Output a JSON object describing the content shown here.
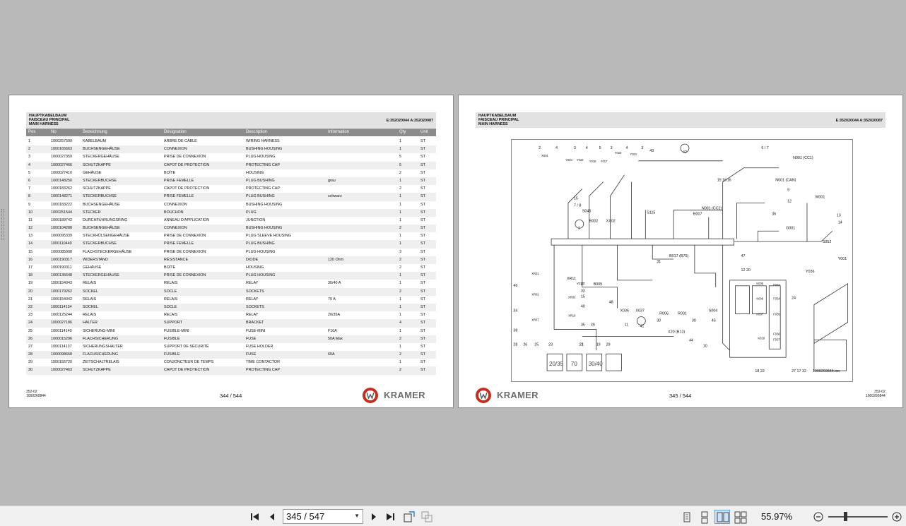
{
  "left_page": {
    "header": {
      "line1": "HAUPTKABELBAUM",
      "line2": "FAISCEAU PRINCIPAL",
      "line3": "MAIN HARNESS",
      "reference": "E:352020044 A:352020087"
    },
    "columns": {
      "pos": "Pos",
      "no": "No",
      "bezeichnung": "Bezeichnung",
      "designation": "Désignation",
      "description": "Description",
      "information": "Information",
      "qty": "Qty",
      "unit": "Unit"
    },
    "rows": [
      {
        "pos": "1",
        "no": "1000257509",
        "bez": "KABELBAUM",
        "des": "ARBRE DE CÂBLE",
        "dsc": "WIRING HARNESS",
        "inf": "",
        "qty": "1",
        "unit": "ST"
      },
      {
        "pos": "2",
        "no": "1000165663",
        "bez": "BUCHSENGEHÄUSE",
        "des": "CONNEXION",
        "dsc": "BUSHING HOUSING",
        "inf": "",
        "qty": "1",
        "unit": "ST"
      },
      {
        "pos": "3",
        "no": "1000027359",
        "bez": "STECKERGEHÄUSE",
        "des": "PRISE DE CONNEXION",
        "dsc": "PLUG HOUSING",
        "inf": "",
        "qty": "5",
        "unit": "ST"
      },
      {
        "pos": "4",
        "no": "1000027466",
        "bez": "SCHUTZKAPPE",
        "des": "CAPOT DE PROTECTION",
        "dsc": "PROTECTING CAP",
        "inf": "",
        "qty": "5",
        "unit": "ST"
      },
      {
        "pos": "5",
        "no": "1000027410",
        "bez": "GEHÄUSE",
        "des": "BOÎTE",
        "dsc": "HOUSING",
        "inf": "",
        "qty": "2",
        "unit": "ST"
      },
      {
        "pos": "6",
        "no": "1000148250",
        "bez": "STECKERBUCHSE",
        "des": "PRISE FEMELLE",
        "dsc": "PLUG BUSHING",
        "inf": "grau",
        "qty": "1",
        "unit": "ST"
      },
      {
        "pos": "7",
        "no": "1000183262",
        "bez": "SCHUTZKAPPE",
        "des": "CAPOT DE PROTECTION",
        "dsc": "PROTECTING CAP",
        "inf": "",
        "qty": "2",
        "unit": "ST"
      },
      {
        "pos": "8",
        "no": "1000148271",
        "bez": "STECKERBUCHSE",
        "des": "PRISE FEMELLE",
        "dsc": "PLUG BUSHING",
        "inf": "schwarz",
        "qty": "1",
        "unit": "ST"
      },
      {
        "pos": "9",
        "no": "1000183222",
        "bez": "BUCHSENGEHÄUSE",
        "des": "CONNEXION",
        "dsc": "BUSHING HOUSING",
        "inf": "",
        "qty": "1",
        "unit": "ST"
      },
      {
        "pos": "10",
        "no": "1000251544",
        "bez": "STECKER",
        "des": "BOUCHON",
        "dsc": "PLUG",
        "inf": "",
        "qty": "1",
        "unit": "ST"
      },
      {
        "pos": "11",
        "no": "1000189742",
        "bez": "DURCHFÜHRUNGSRING",
        "des": "ANNEAU D'APPLICATION",
        "dsc": "JUNCTION",
        "inf": "",
        "qty": "1",
        "unit": "ST"
      },
      {
        "pos": "12",
        "no": "1000104288",
        "bez": "BUCHSENGEHÄUSE",
        "des": "CONNEXION",
        "dsc": "BUSHING HOUSING",
        "inf": "",
        "qty": "2",
        "unit": "ST"
      },
      {
        "pos": "13",
        "no": "1000095339",
        "bez": "STECKHÜLSENGEHÄUSE",
        "des": "PRISE DE CONNEXION",
        "dsc": "PLUG SLEEVE HOUSING",
        "inf": "",
        "qty": "1",
        "unit": "ST"
      },
      {
        "pos": "14",
        "no": "1000110449",
        "bez": "STECKERBUCHSE",
        "des": "PRISE FEMELLE",
        "dsc": "PLUG BUSHING",
        "inf": "",
        "qty": "1",
        "unit": "ST"
      },
      {
        "pos": "15",
        "no": "1000085008",
        "bez": "FLACHSTECKERGEHÄUSE",
        "des": "PRISE DE CONNEXION",
        "dsc": "PLUG HOUSING",
        "inf": "",
        "qty": "3",
        "unit": "ST"
      },
      {
        "pos": "16",
        "no": "1000190317",
        "bez": "WIDERSTAND",
        "des": "RÉSISTANCE",
        "dsc": "DIODE",
        "inf": "120 Ohm",
        "qty": "2",
        "unit": "ST"
      },
      {
        "pos": "17",
        "no": "1000190311",
        "bez": "GEHÄUSE",
        "des": "BOÎTE",
        "dsc": "HOUSING",
        "inf": "",
        "qty": "2",
        "unit": "ST"
      },
      {
        "pos": "18",
        "no": "1000135648",
        "bez": "STECKERGEHÄUSE",
        "des": "PRISE DE CONNEXION",
        "dsc": "PLUG HOUSING",
        "inf": "",
        "qty": "1",
        "unit": "ST"
      },
      {
        "pos": "19",
        "no": "1000154043",
        "bez": "RELAIS",
        "des": "RELAIS",
        "dsc": "RELAY",
        "inf": "30/40 A",
        "qty": "1",
        "unit": "ST"
      },
      {
        "pos": "20",
        "no": "1000179262",
        "bez": "SOCKEL",
        "des": "SOCLE",
        "dsc": "SOCKETS",
        "inf": "",
        "qty": "2",
        "unit": "ST"
      },
      {
        "pos": "21",
        "no": "1000154042",
        "bez": "RELAIS",
        "des": "RELAIS",
        "dsc": "RELAY",
        "inf": "70 A",
        "qty": "1",
        "unit": "ST"
      },
      {
        "pos": "22",
        "no": "1000114134",
        "bez": "SOCKEL",
        "des": "SOCLE",
        "dsc": "SOCKETS",
        "inf": "",
        "qty": "1",
        "unit": "ST"
      },
      {
        "pos": "23",
        "no": "1000125244",
        "bez": "RELAIS",
        "des": "RELAIS",
        "dsc": "RELAY",
        "inf": "20/35A",
        "qty": "1",
        "unit": "ST"
      },
      {
        "pos": "24",
        "no": "1000027186",
        "bez": "HALTER",
        "des": "SUPPORT",
        "dsc": "BRACKET",
        "inf": "",
        "qty": "4",
        "unit": "ST"
      },
      {
        "pos": "25",
        "no": "1000114140",
        "bez": "SICHERUNG-MINI",
        "des": "FUSIBLE-MINI",
        "dsc": "FUSE-MINI",
        "inf": "F10A",
        "qty": "1",
        "unit": "ST"
      },
      {
        "pos": "26",
        "no": "1000015296",
        "bez": "FLACHSICHERUNG",
        "des": "FUSIBLE",
        "dsc": "FUSE",
        "inf": "50A Max",
        "qty": "2",
        "unit": "ST"
      },
      {
        "pos": "27",
        "no": "1000114137",
        "bez": "SICHERUNGSHALTER",
        "des": "SUPPORT DE SÉCURITÉ",
        "dsc": "FUSE HOLDER",
        "inf": "",
        "qty": "1",
        "unit": "ST"
      },
      {
        "pos": "28",
        "no": "1000098668",
        "bez": "FLACHSICHERUNG",
        "des": "FUSIBLE",
        "dsc": "FUSE",
        "inf": "60A",
        "qty": "2",
        "unit": "ST"
      },
      {
        "pos": "29",
        "no": "1000155720",
        "bez": "ZEITSCHALTRELAIS",
        "des": "CONJONCTEUR DE TEMPS",
        "dsc": "TIME CONTACTOR",
        "inf": "",
        "qty": "1",
        "unit": "ST"
      },
      {
        "pos": "30",
        "no": "1000027463",
        "bez": "SCHUTZKAPPE",
        "des": "CAPOT DE PROTECTION",
        "dsc": "PROTECTING CAP",
        "inf": "",
        "qty": "2",
        "unit": "ST"
      }
    ],
    "footer_code1": "352-02",
    "footer_code2": "1000260844",
    "page_number": "344 / 544",
    "logo_name": "KRAMER"
  },
  "right_page": {
    "header": {
      "line1": "HAUPTKABELBAUM",
      "line2": "FAISCEAU PRINCIPAL",
      "line3": "MAIN HARNESS",
      "reference": "E:352020044 A:352020087"
    },
    "diagram": {
      "callouts": [
        "2",
        "4",
        "3",
        "4",
        "5",
        "3",
        "4",
        "3",
        "43",
        "42",
        "6 / 7",
        "N001 (CC1)",
        "N001 (CAN)",
        "9",
        "15 16",
        "16",
        "15",
        "7 / 8",
        "12",
        "N001 (CC2)",
        "36",
        "G001",
        "M001",
        "13",
        "14",
        "S045",
        "B002",
        "XX02",
        "S115",
        "B007",
        "1",
        "S052",
        "Y001",
        "Y036",
        "47",
        "12 20",
        "31",
        "B017 (B75)",
        "XR11",
        "37",
        "33",
        "15",
        "40",
        "35",
        "46",
        "34",
        "38",
        "48",
        "X036",
        "X037",
        "B005",
        "R006",
        "R001",
        "30",
        "30",
        "S004",
        "45",
        "24",
        "21",
        "39",
        "11",
        "41",
        "X20 (B13)",
        "44",
        "10",
        "28",
        "26",
        "25",
        "23",
        "21",
        "19",
        "29",
        "18 22",
        "27 17 32",
        "1000260844.iso"
      ],
      "relay_labels": [
        "20/35",
        "70",
        "30/40"
      ],
      "connector_labels": [
        "X001",
        "Y020",
        "Y022",
        "Y018",
        "Y017",
        "Y020",
        "Y021",
        "V010",
        "XR01",
        "XR02",
        "XR03",
        "XR07",
        "XR10",
        "K005",
        "K006",
        "K007",
        "F033",
        "F034",
        "F035",
        "F036",
        "F037",
        "K029"
      ]
    },
    "footer_code1": "352-02",
    "footer_code2": "1000260844",
    "page_number": "345 / 544",
    "logo_name": "KRAMER"
  },
  "toolbar": {
    "page_input": "345 / 547",
    "zoom_level": "55.97%"
  }
}
